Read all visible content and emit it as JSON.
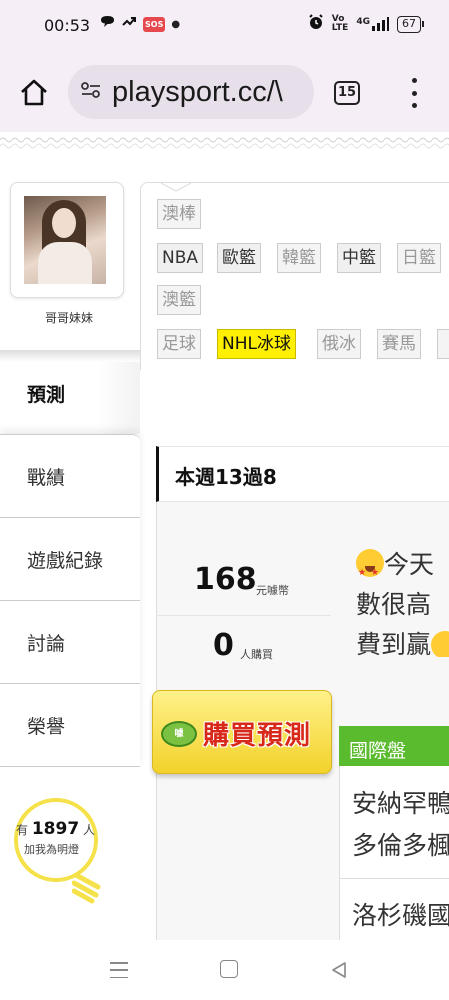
{
  "status_bar": {
    "time": "00:53",
    "sos": "SOS",
    "network": "4G",
    "battery": "67"
  },
  "browser": {
    "url": "playsport.cc/\\",
    "tab_count": "15"
  },
  "profile": {
    "name": "哥哥妹妹"
  },
  "sidebar": {
    "active": "預測",
    "items": [
      {
        "label": "戰績"
      },
      {
        "label": "遊戲紀錄"
      },
      {
        "label": "討論"
      },
      {
        "label": "榮譽"
      }
    ]
  },
  "light": {
    "prefix": "有",
    "count": "1897",
    "suffix": "人",
    "caption": "加我為明燈"
  },
  "sport_tags": [
    {
      "label": "澳棒",
      "state": "inactive"
    },
    {
      "label": "NBA",
      "state": "active"
    },
    {
      "label": "歐籃",
      "state": "active"
    },
    {
      "label": "韓籃",
      "state": "inactive"
    },
    {
      "label": "中籃",
      "state": "active"
    },
    {
      "label": "日籃",
      "state": "inactive"
    },
    {
      "label": "澳籃",
      "state": "inactive"
    },
    {
      "label": "足球",
      "state": "inactive"
    },
    {
      "label": "NHL冰球",
      "state": "selected"
    },
    {
      "label": "俄冰",
      "state": "inactive"
    },
    {
      "label": "賽馬",
      "state": "inactive"
    }
  ],
  "main": {
    "week_title": "本週13過8",
    "coins": "168",
    "coins_unit": "元噱幣",
    "buyers": "0",
    "buyers_unit": "人購買",
    "buy_button": "購買預測",
    "buy_coin_label": "噱",
    "message_line1": "今天",
    "message_line2": "數很高",
    "message_line3": "費到贏",
    "section_label": "國際盤",
    "game1_line1": "安納罕鴨",
    "game1_line2": "多倫多楓",
    "game2_line1": "洛杉磯國"
  },
  "colors": {
    "status_bg": "#f6eef7",
    "highlight_tag": "#ffef00",
    "section_green": "#5bbb2e",
    "buy_red": "#d8281a"
  }
}
